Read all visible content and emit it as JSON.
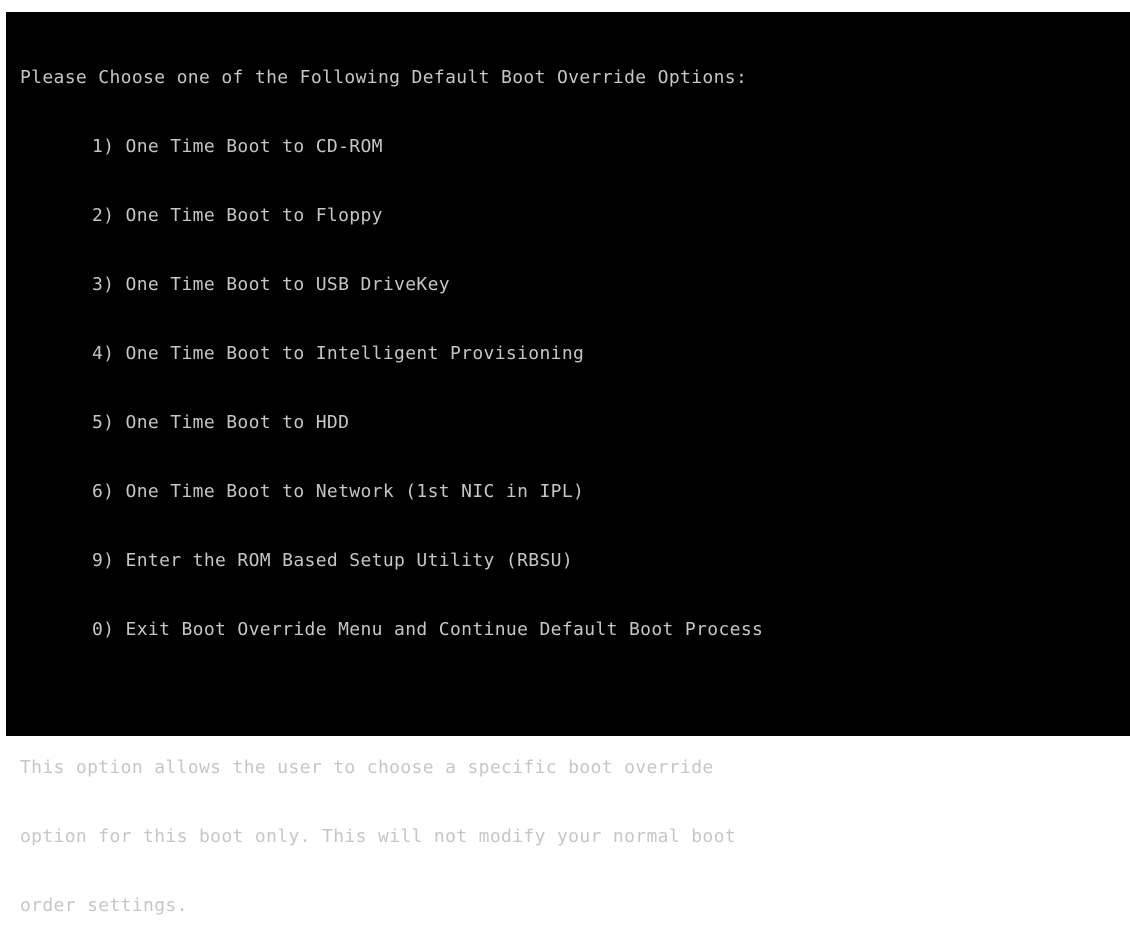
{
  "screen": {
    "header": "Please Choose one of the Following Default Boot Override Options:",
    "options": [
      "1) One Time Boot to CD-ROM",
      "2) One Time Boot to Floppy",
      "3) One Time Boot to USB DriveKey",
      "4) One Time Boot to Intelligent Provisioning",
      "5) One Time Boot to HDD",
      "6) One Time Boot to Network (1st NIC in IPL)",
      "9) Enter the ROM Based Setup Utility (RBSU)",
      "0) Exit Boot Override Menu and Continue Default Boot Process"
    ],
    "description": [
      "This option allows the user to choose a specific boot override",
      "option for this boot only. This will not modify your normal boot",
      "order settings."
    ]
  },
  "colors": {
    "background": "#000000",
    "text": "#c6c6c6"
  }
}
